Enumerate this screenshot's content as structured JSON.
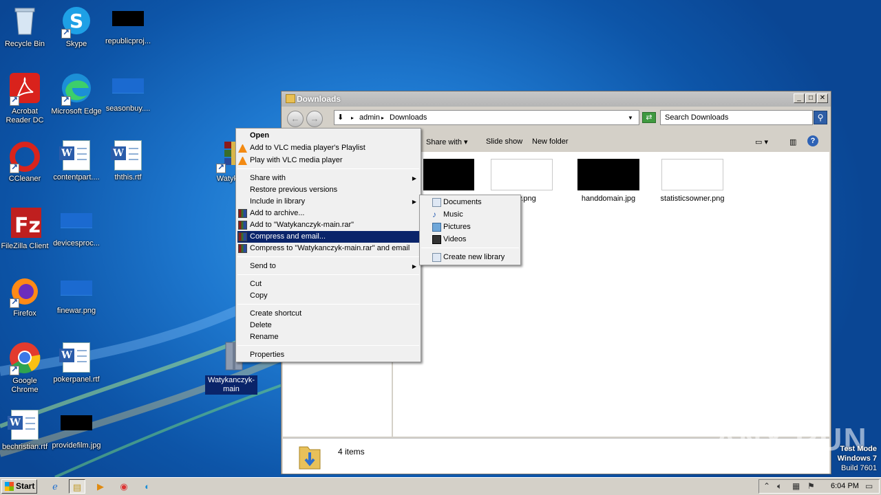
{
  "desktop": {
    "icons": [
      {
        "label": "Recycle Bin"
      },
      {
        "label": "Skype"
      },
      {
        "label": "republicproj..."
      },
      {
        "label": "Acrobat\nReader DC"
      },
      {
        "label": "Microsoft Edge"
      },
      {
        "label": "seasonbuy...."
      },
      {
        "label": "CCleaner"
      },
      {
        "label": "contentpart...."
      },
      {
        "label": "ththis.rtf"
      },
      {
        "label": "Watykan"
      },
      {
        "label": "FileZilla Client"
      },
      {
        "label": "devicesproc..."
      },
      {
        "label": "Firefox"
      },
      {
        "label": "finewar.png"
      },
      {
        "label": "Google\nChrome"
      },
      {
        "label": "pokerpanel.rtf"
      },
      {
        "label": "Watykanczyk-\nmain"
      },
      {
        "label": "bechristian.rtf"
      },
      {
        "label": "providefilm.jpg"
      }
    ]
  },
  "explorer": {
    "title": "Downloads",
    "address": {
      "segment1": "admin",
      "segment2": "Downloads"
    },
    "search_placeholder": "Search Downloads",
    "toolbar": {
      "share_with": "Share with",
      "slide_show": "Slide show",
      "new_folder": "New folder"
    },
    "files": [
      {
        "name": ""
      },
      {
        "name": "...rly.png"
      },
      {
        "name": "handdomain.jpg"
      },
      {
        "name": "statisticsowner.png"
      }
    ],
    "status": "4 items"
  },
  "context_menu": {
    "items": {
      "open": "Open",
      "vlc_playlist": "Add to VLC media player's Playlist",
      "vlc_play": "Play with VLC media player",
      "share_with": "Share with",
      "restore": "Restore previous versions",
      "include_library": "Include in library",
      "add_archive": "Add to archive...",
      "add_rar": "Add to \"Watykanczyk-main.rar\"",
      "compress_email": "Compress and email...",
      "compress_rar_email": "Compress to \"Watykanczyk-main.rar\" and email",
      "send_to": "Send to",
      "cut": "Cut",
      "copy": "Copy",
      "create_shortcut": "Create shortcut",
      "delete": "Delete",
      "rename": "Rename",
      "properties": "Properties"
    }
  },
  "library_submenu": {
    "documents": "Documents",
    "music": "Music",
    "pictures": "Pictures",
    "videos": "Videos",
    "create_new": "Create new library"
  },
  "taskbar": {
    "start": "Start",
    "clock": "6:04 PM"
  },
  "watermark": {
    "line1": "Test Mode",
    "line2": "Windows 7",
    "line3": "Build 7601"
  },
  "brand_overlay": "ANY RUN",
  "colors": {
    "highlight": "#0a246a",
    "desktop": "#1e78cf"
  }
}
